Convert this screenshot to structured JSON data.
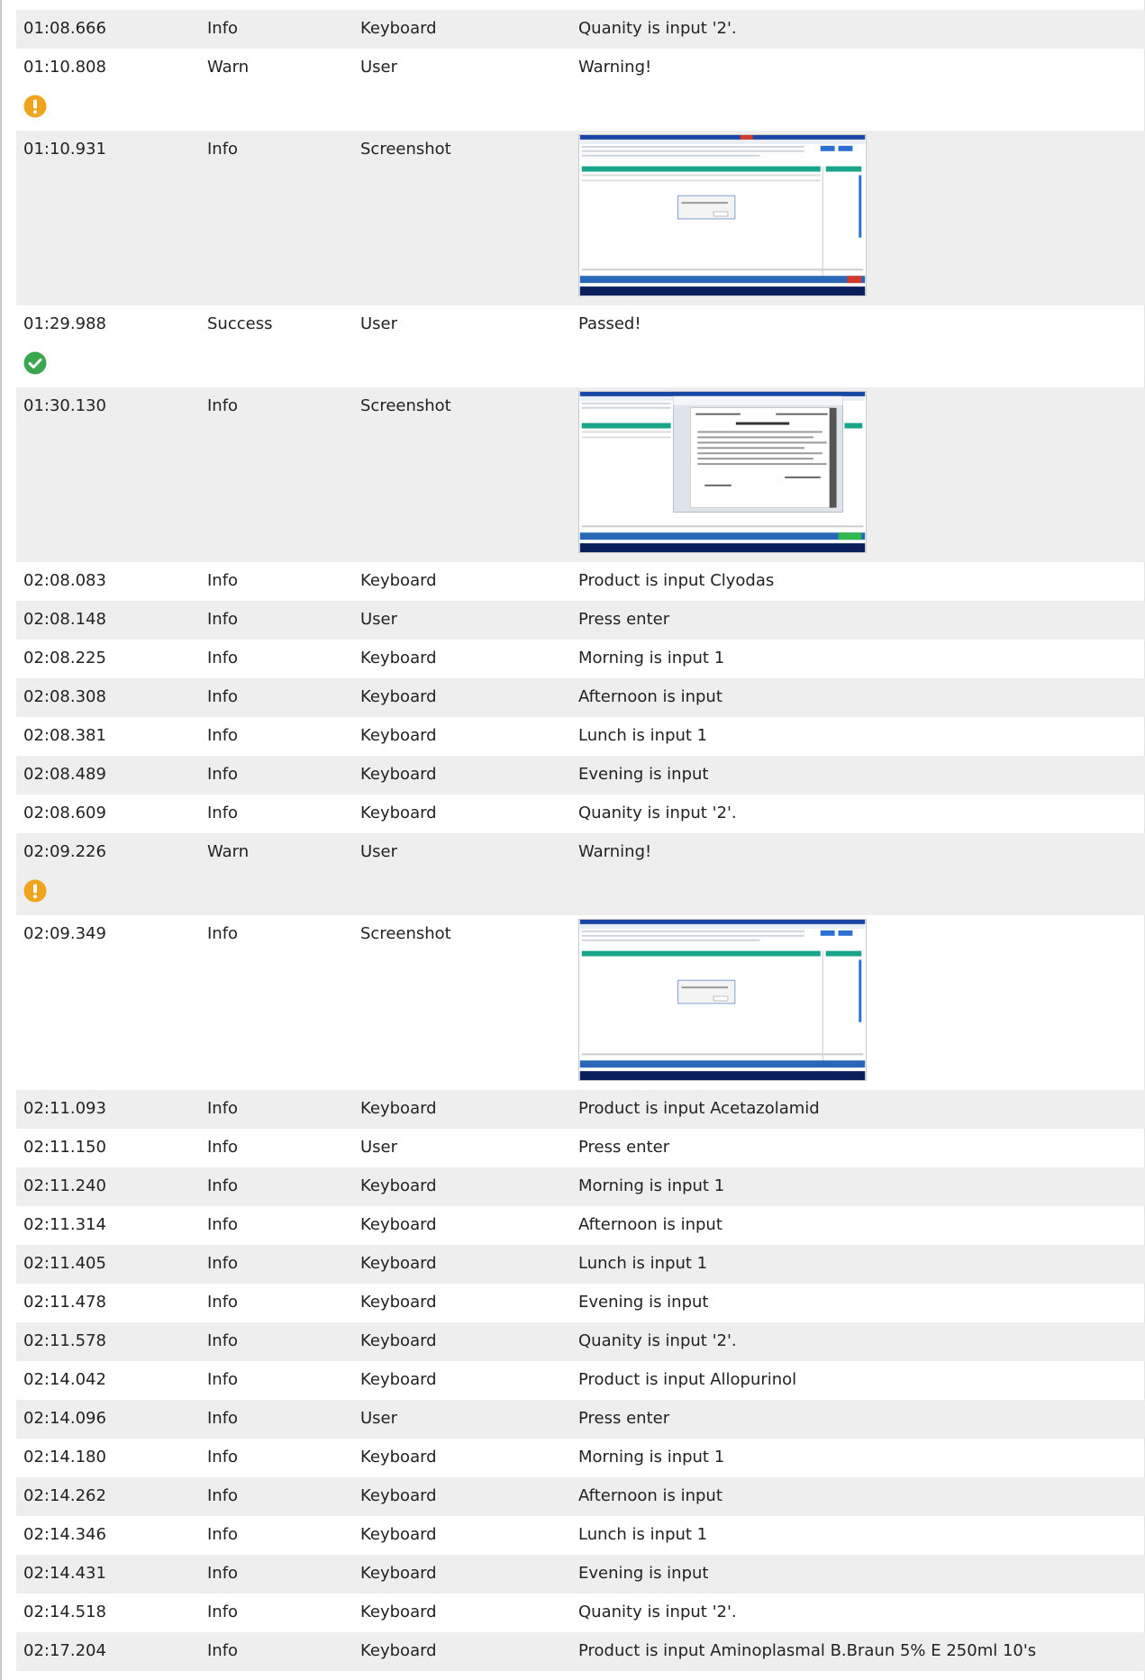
{
  "colors": {
    "row_shaded": "#eeeeee",
    "warn": "#f0a31c",
    "success": "#3aa74d",
    "app_green": "#19a58a",
    "app_blue": "#1a47a6"
  },
  "log": [
    {
      "time": "01:08.666",
      "level": "Info",
      "source": "Keyboard",
      "message": "Quanity is input '2'."
    },
    {
      "time": "01:10.808",
      "level": "Warn",
      "source": "User",
      "message": "Warning!",
      "icon": "warning-icon"
    },
    {
      "time": "01:10.931",
      "level": "Info",
      "source": "Screenshot",
      "message": "",
      "screenshot": "dialog-screenshot"
    },
    {
      "time": "01:29.988",
      "level": "Success",
      "source": "User",
      "message": "Passed!",
      "icon": "check-circle-icon"
    },
    {
      "time": "01:30.130",
      "level": "Info",
      "source": "Screenshot",
      "message": "",
      "screenshot": "document-screenshot"
    },
    {
      "time": "02:08.083",
      "level": "Info",
      "source": "Keyboard",
      "message": "Product is input Clyodas"
    },
    {
      "time": "02:08.148",
      "level": "Info",
      "source": "User",
      "message": "Press enter"
    },
    {
      "time": "02:08.225",
      "level": "Info",
      "source": "Keyboard",
      "message": "Morning is input 1"
    },
    {
      "time": "02:08.308",
      "level": "Info",
      "source": "Keyboard",
      "message": "Afternoon is input"
    },
    {
      "time": "02:08.381",
      "level": "Info",
      "source": "Keyboard",
      "message": "Lunch is input 1"
    },
    {
      "time": "02:08.489",
      "level": "Info",
      "source": "Keyboard",
      "message": "Evening is input"
    },
    {
      "time": "02:08.609",
      "level": "Info",
      "source": "Keyboard",
      "message": "Quanity is input '2'."
    },
    {
      "time": "02:09.226",
      "level": "Warn",
      "source": "User",
      "message": "Warning!",
      "icon": "warning-icon"
    },
    {
      "time": "02:09.349",
      "level": "Info",
      "source": "Screenshot",
      "message": "",
      "screenshot": "empty-dialog-screenshot"
    },
    {
      "time": "02:11.093",
      "level": "Info",
      "source": "Keyboard",
      "message": "Product is input Acetazolamid"
    },
    {
      "time": "02:11.150",
      "level": "Info",
      "source": "User",
      "message": "Press enter"
    },
    {
      "time": "02:11.240",
      "level": "Info",
      "source": "Keyboard",
      "message": "Morning is input 1"
    },
    {
      "time": "02:11.314",
      "level": "Info",
      "source": "Keyboard",
      "message": "Afternoon is input"
    },
    {
      "time": "02:11.405",
      "level": "Info",
      "source": "Keyboard",
      "message": "Lunch is input 1"
    },
    {
      "time": "02:11.478",
      "level": "Info",
      "source": "Keyboard",
      "message": "Evening is input"
    },
    {
      "time": "02:11.578",
      "level": "Info",
      "source": "Keyboard",
      "message": "Quanity is input '2'."
    },
    {
      "time": "02:14.042",
      "level": "Info",
      "source": "Keyboard",
      "message": "Product is input Allopurinol"
    },
    {
      "time": "02:14.096",
      "level": "Info",
      "source": "User",
      "message": "Press enter"
    },
    {
      "time": "02:14.180",
      "level": "Info",
      "source": "Keyboard",
      "message": "Morning is input 1"
    },
    {
      "time": "02:14.262",
      "level": "Info",
      "source": "Keyboard",
      "message": "Afternoon is input"
    },
    {
      "time": "02:14.346",
      "level": "Info",
      "source": "Keyboard",
      "message": "Lunch is input 1"
    },
    {
      "time": "02:14.431",
      "level": "Info",
      "source": "Keyboard",
      "message": "Evening is input"
    },
    {
      "time": "02:14.518",
      "level": "Info",
      "source": "Keyboard",
      "message": "Quanity is input '2'."
    },
    {
      "time": "02:17.204",
      "level": "Info",
      "source": "Keyboard",
      "message": "Product is input Aminoplasmal B.Braun 5% E 250ml 10's"
    }
  ]
}
